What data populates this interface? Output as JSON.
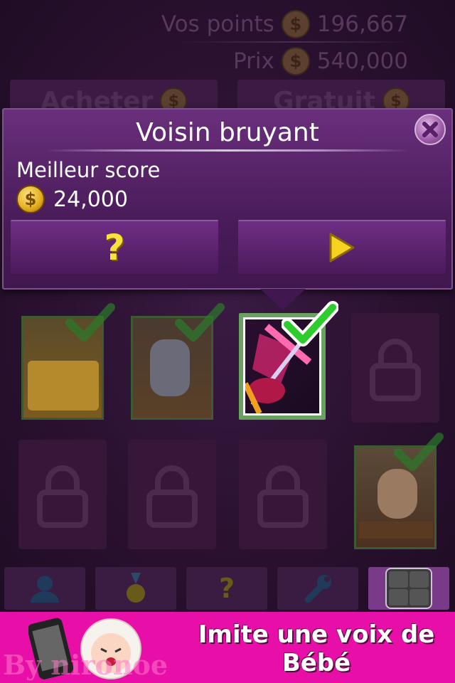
{
  "header": {
    "points_label": "Vos points",
    "points_value": "196,667",
    "price_label": "Prix",
    "price_value": "540,000",
    "buy_label": "Acheter",
    "free_label": "Gratuit"
  },
  "popup": {
    "title": "Voisin bruyant",
    "best_score_label": "Meilleur score",
    "best_score_value": "24,000",
    "coin_symbol": "$",
    "help_symbol": "?"
  },
  "grid": {
    "row1": [
      {
        "name": "slot-machine-level",
        "state": "completed"
      },
      {
        "name": "cartoon-level",
        "state": "completed"
      },
      {
        "name": "guitar-level",
        "state": "selected"
      },
      {
        "name": "locked-level",
        "state": "locked"
      }
    ],
    "row2": [
      {
        "name": "locked-level",
        "state": "locked"
      },
      {
        "name": "locked-level",
        "state": "locked"
      },
      {
        "name": "locked-level",
        "state": "locked"
      },
      {
        "name": "sumo-level",
        "state": "completed"
      }
    ]
  },
  "nav": {
    "items": [
      "profile-icon",
      "medal-icon",
      "help-icon",
      "wrench-icon",
      "tools-icon"
    ]
  },
  "ad": {
    "line1": "Imite une voix de",
    "line2": "Bébé",
    "watermark": "By nironoe"
  },
  "colors": {
    "accent": "#e80fa8",
    "popup": "#5a2369",
    "check": "#2ecc2e"
  }
}
